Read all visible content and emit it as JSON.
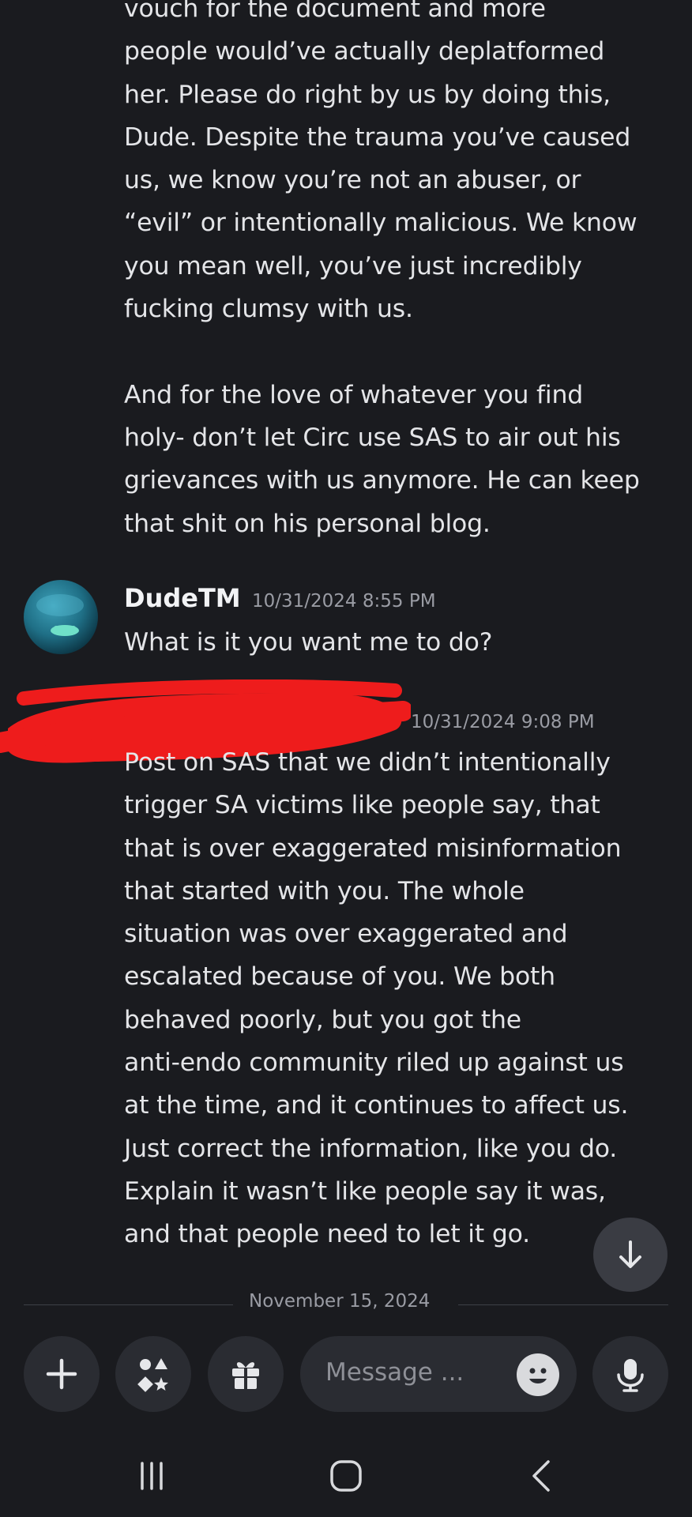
{
  "messages": [
    {
      "lines": [
        "vouch for the document and more",
        "people would’ve actually deplatformed",
        "her. Please do right by us by doing this,",
        "Dude. Despite the trauma you’ve caused",
        "us, we know you’re not an abuser, or",
        "“evil” or intentionally malicious. We know",
        "you mean well, you’ve just incredibly",
        "fucking clumsy with us.",
        "",
        "And for the love of whatever you find",
        "holy- don’t let Circ use SAS to air out his",
        "grievances with us anymore. He can keep",
        "that shit on his personal blog."
      ]
    },
    {
      "author": "DudeTM",
      "timestamp": "10/31/2024 8:55 PM",
      "lines": [
        "What is it you want me to do?"
      ]
    },
    {
      "timestamp": "10/31/2024 9:08 PM",
      "lines": [
        "Post on SAS that we didn’t intentionally",
        "trigger SA victims like people say, that",
        "that is over exaggerated misinformation",
        "that started with you. The whole",
        "situation was over exaggerated and",
        "escalated because of you. We both",
        "behaved poorly, but you got the",
        "anti-endo community riled up against us",
        "at the time, and it continues to affect us.",
        "Just correct the information, like you do.",
        "Explain it wasn’t like people say it was,",
        "and that people need to let it go."
      ]
    }
  ],
  "date_divider": "November 15, 2024",
  "composer": {
    "placeholder": "Message ...",
    "icons": [
      "plus-icon",
      "apps-icon",
      "gift-icon",
      "emoji-icon",
      "microphone-icon"
    ]
  },
  "nav_icons": [
    "recents-icon",
    "home-icon",
    "back-icon"
  ],
  "colors": {
    "background": "#1a1b1f",
    "bubble": "#2a2c32",
    "redaction": "#ee1c1c",
    "muted_text": "#9a9ca4"
  }
}
